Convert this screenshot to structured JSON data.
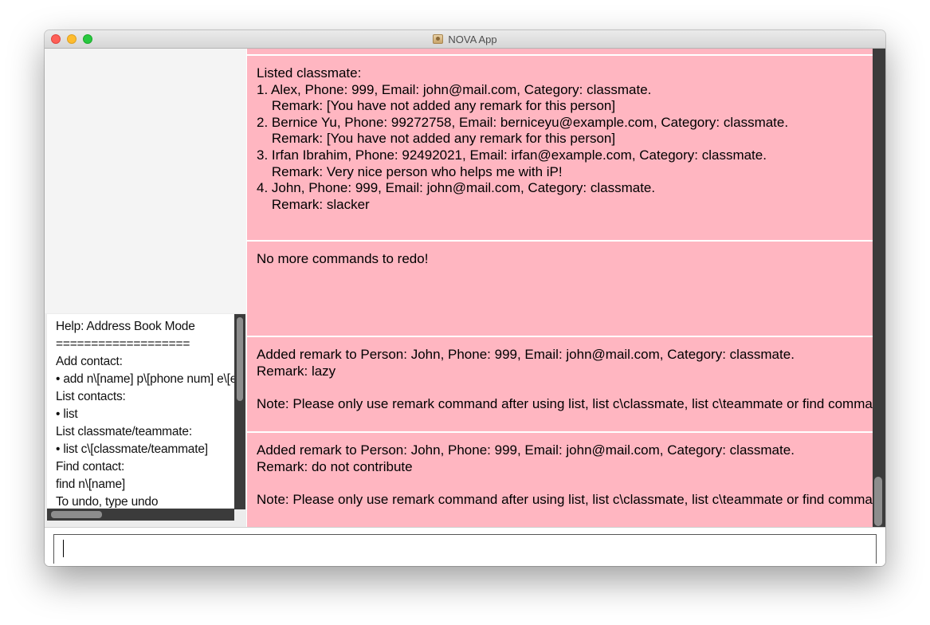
{
  "window": {
    "title": "NOVA App",
    "app_icon": "address-book-icon"
  },
  "help": {
    "text": "Help: Address Book Mode\n===================\nAdd contact:\n• add n\\[name] p\\[phone num] e\\[email] c\\[category]\nList contacts:\n• list\nList classmate/teammate:\n• list c\\[classmate/teammate]\nFind contact:\nfind n\\[name]\nTo undo, type undo"
  },
  "results": [
    {
      "text": "Listed classmate:\n1. Alex, Phone: 999, Email: john@mail.com, Category: classmate.\n    Remark: [You have not added any remark for this person]\n2. Bernice Yu, Phone: 99272758, Email: berniceyu@example.com, Category: classmate.\n    Remark: [You have not added any remark for this person]\n3. Irfan Ibrahim, Phone: 92492021, Email: irfan@example.com, Category: classmate.\n    Remark: Very nice person who helps me with iP!\n4. John, Phone: 999, Email: john@mail.com, Category: classmate.\n    Remark: slacker"
    },
    {
      "text": "No more commands to redo!"
    },
    {
      "text": "Added remark to Person: John, Phone: 999, Email: john@mail.com, Category: classmate.\nRemark: lazy\n\nNote: Please only use remark command after using list, list c\\classmate, list c\\teammate or find command"
    },
    {
      "text": "Added remark to Person: John, Phone: 999, Email: john@mail.com, Category: classmate.\nRemark: do not contribute\n\nNote: Please only use remark command after using list, list c\\classmate, list c\\teammate or find command"
    }
  ],
  "command_box": {
    "value": ""
  },
  "colors": {
    "result_card_bg": "#ffb6c1",
    "scrollbar_track": "#3b3b3b",
    "scrollbar_thumb": "#8d8d8d"
  }
}
